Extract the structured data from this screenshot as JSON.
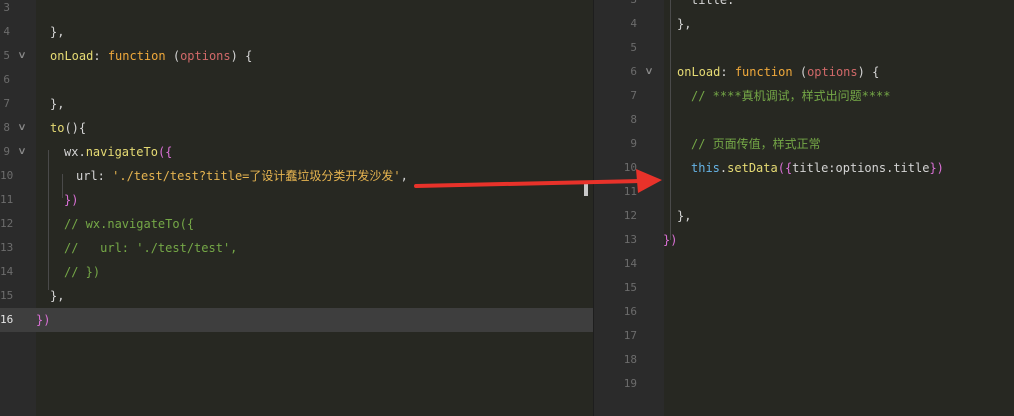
{
  "left_editor": {
    "lines": [
      {
        "num": "3",
        "segs": []
      },
      {
        "num": "4",
        "segs": [
          {
            "t": "},",
            "c": "k-pun"
          }
        ]
      },
      {
        "num": "5",
        "segs": [
          {
            "t": "onLoad",
            "c": "k-fn"
          },
          {
            "t": ": ",
            "c": "k-pun"
          },
          {
            "t": "function",
            "c": "k-kw"
          },
          {
            "t": " (",
            "c": "k-pun"
          },
          {
            "t": "options",
            "c": "k-param"
          },
          {
            "t": ") {",
            "c": "k-pun"
          }
        ]
      },
      {
        "num": "6",
        "segs": []
      },
      {
        "num": "7",
        "segs": [
          {
            "t": "},",
            "c": "k-pun"
          }
        ]
      },
      {
        "num": "8",
        "segs": [
          {
            "t": "to",
            "c": "k-fn"
          },
          {
            "t": "(){",
            "c": "k-pun"
          }
        ]
      },
      {
        "num": "9",
        "segs": [
          {
            "t": "wx.",
            "c": "k-prop"
          },
          {
            "t": "navigateTo",
            "c": "k-fn"
          },
          {
            "t": "({",
            "c": "k-br2"
          }
        ]
      },
      {
        "num": "10",
        "segs": [
          {
            "t": "url: ",
            "c": "k-prop"
          },
          {
            "t": "'./test/test?title=了设计蠢垃圾分类开发沙发'",
            "c": "k-str"
          },
          {
            "t": ",",
            "c": "k-pun"
          }
        ]
      },
      {
        "num": "11",
        "segs": [
          {
            "t": "})",
            "c": "k-br2"
          }
        ]
      },
      {
        "num": "12",
        "segs": [
          {
            "t": "// wx.navigateTo({",
            "c": "k-com"
          }
        ]
      },
      {
        "num": "13",
        "segs": [
          {
            "t": "//   url: './test/test',",
            "c": "k-com"
          }
        ]
      },
      {
        "num": "14",
        "segs": [
          {
            "t": "// })",
            "c": "k-com"
          }
        ]
      },
      {
        "num": "15",
        "segs": [
          {
            "t": "},",
            "c": "k-pun"
          }
        ]
      },
      {
        "num": "16",
        "segs": [
          {
            "t": "})",
            "c": "k-br2"
          }
        ]
      }
    ]
  },
  "right_editor": {
    "lines": [
      {
        "num": "3",
        "segs": [
          {
            "t": "title:''",
            "c": "k-prop"
          }
        ]
      },
      {
        "num": "4",
        "segs": [
          {
            "t": "},",
            "c": "k-pun"
          }
        ]
      },
      {
        "num": "5",
        "segs": []
      },
      {
        "num": "6",
        "segs": [
          {
            "t": "onLoad",
            "c": "k-fn"
          },
          {
            "t": ": ",
            "c": "k-pun"
          },
          {
            "t": "function",
            "c": "k-kw"
          },
          {
            "t": " (",
            "c": "k-pun"
          },
          {
            "t": "options",
            "c": "k-param"
          },
          {
            "t": ") {",
            "c": "k-pun"
          }
        ]
      },
      {
        "num": "7",
        "segs": [
          {
            "t": "// ****真机调试，样式出问题****",
            "c": "k-com"
          }
        ]
      },
      {
        "num": "8",
        "segs": []
      },
      {
        "num": "9",
        "segs": [
          {
            "t": "// 页面传值，样式正常",
            "c": "k-com"
          }
        ]
      },
      {
        "num": "10",
        "segs": [
          {
            "t": "this",
            "c": "k-this"
          },
          {
            "t": ".",
            "c": "k-pun"
          },
          {
            "t": "setData",
            "c": "k-fn"
          },
          {
            "t": "({",
            "c": "k-br2"
          },
          {
            "t": "title:options.title",
            "c": "k-prop"
          },
          {
            "t": "})",
            "c": "k-br2"
          }
        ]
      },
      {
        "num": "11",
        "segs": []
      },
      {
        "num": "12",
        "segs": [
          {
            "t": "},",
            "c": "k-pun"
          }
        ]
      },
      {
        "num": "13",
        "segs": [
          {
            "t": "})",
            "c": "k-br2"
          }
        ]
      },
      {
        "num": "14",
        "segs": []
      },
      {
        "num": "15",
        "segs": []
      },
      {
        "num": "16",
        "segs": []
      },
      {
        "num": "17",
        "segs": []
      },
      {
        "num": "18",
        "segs": []
      },
      {
        "num": "19",
        "segs": []
      }
    ]
  },
  "annotation": {
    "arrow_color": "#e8322a"
  },
  "theme": {
    "background": "#2b2b2b",
    "active_line": "#3e3e3e"
  }
}
